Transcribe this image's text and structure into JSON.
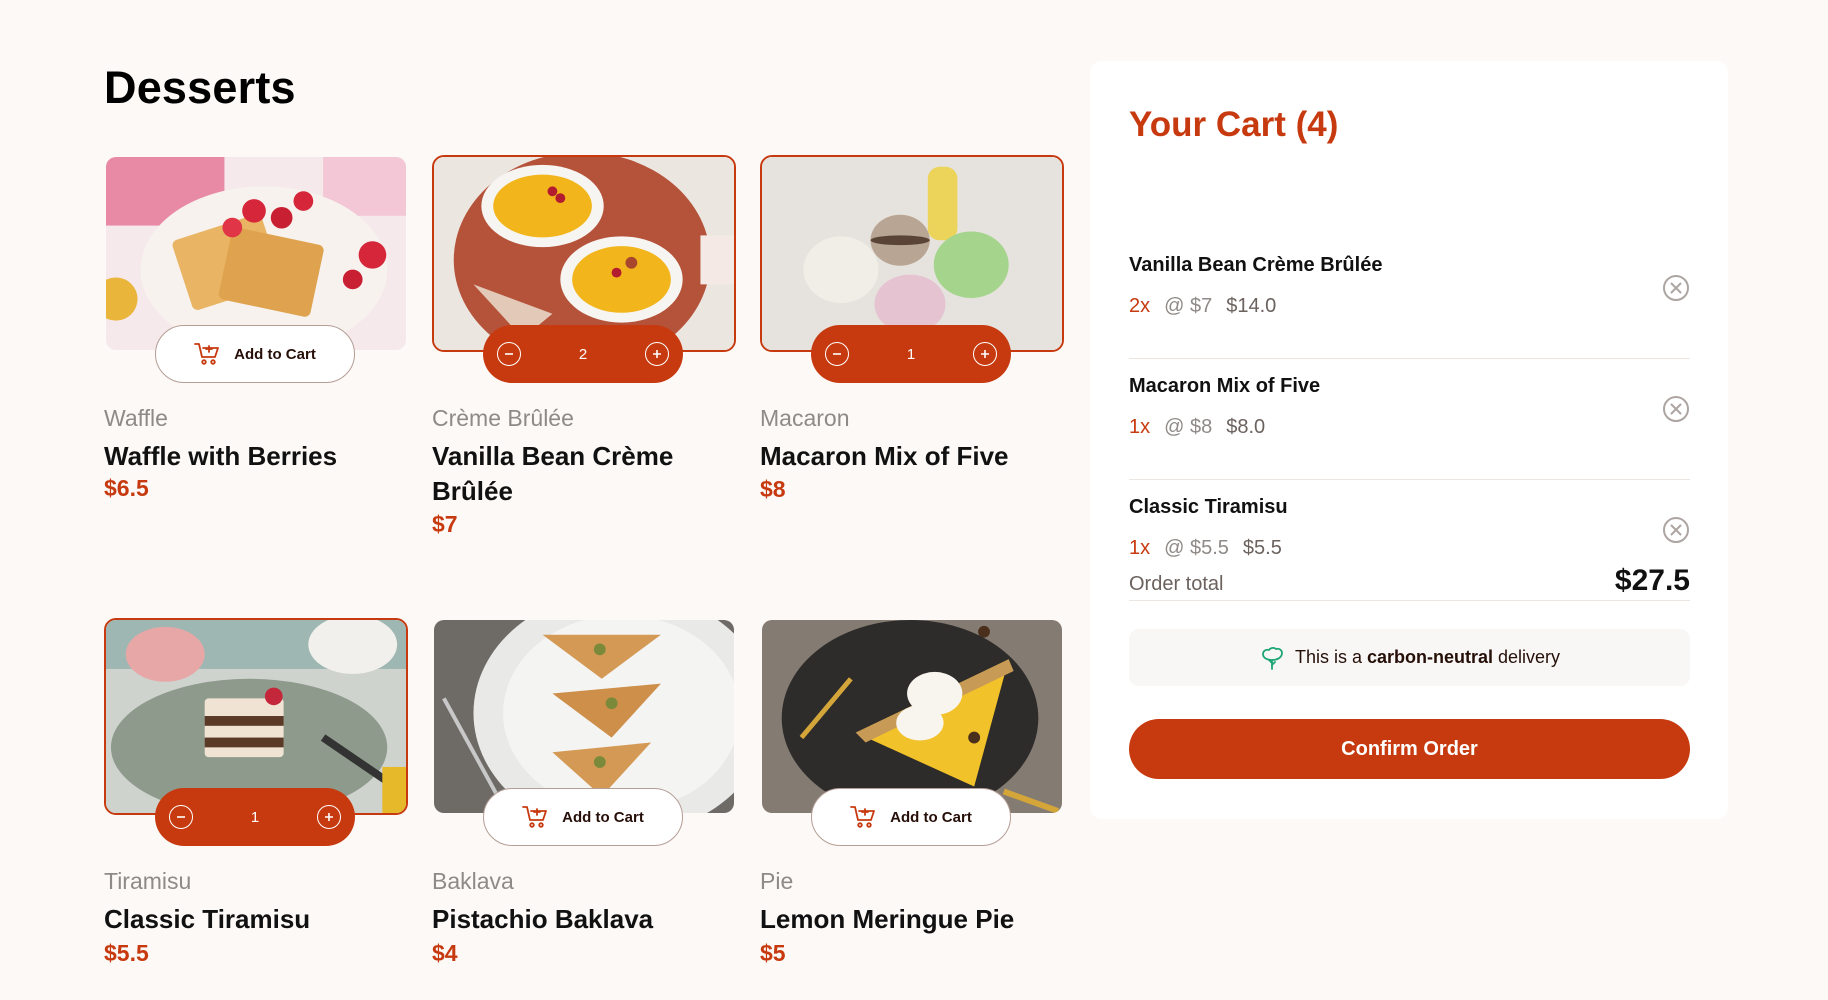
{
  "page": {
    "title": "Desserts"
  },
  "products": [
    {
      "category": "Waffle",
      "name": "Waffle with Berries",
      "price": "$6.5",
      "in_cart": false,
      "add_label": "Add to Cart"
    },
    {
      "category": "Crème Brûlée",
      "name": "Vanilla Bean Crème Brûlée",
      "price": "$7",
      "in_cart": true,
      "quantity": "2"
    },
    {
      "category": "Macaron",
      "name": "Macaron Mix of Five",
      "price": "$8",
      "in_cart": true,
      "quantity": "1"
    },
    {
      "category": "Tiramisu",
      "name": "Classic Tiramisu",
      "price": "$5.5",
      "in_cart": true,
      "quantity": "1"
    },
    {
      "category": "Baklava",
      "name": "Pistachio Baklava",
      "price": "$4",
      "in_cart": false,
      "add_label": "Add to Cart"
    },
    {
      "category": "Pie",
      "name": "Lemon Meringue Pie",
      "price": "$5",
      "in_cart": false,
      "add_label": "Add to Cart"
    }
  ],
  "cart": {
    "title": "Your Cart (4)",
    "items": [
      {
        "name": "Vanilla Bean Crème Brûlée",
        "qty": "2x",
        "unit": "@ $7",
        "total": "$14.0"
      },
      {
        "name": "Macaron Mix of Five",
        "qty": "1x",
        "unit": "@ $8",
        "total": "$8.0"
      },
      {
        "name": "Classic Tiramisu",
        "qty": "1x",
        "unit": "@ $5.5",
        "total": "$5.5"
      }
    ],
    "order_total_label": "Order total",
    "order_total": "$27.5",
    "carbon_prefix": "This is a ",
    "carbon_bold": "carbon-neutral",
    "carbon_suffix": " delivery",
    "confirm_label": "Confirm Order"
  },
  "colors": {
    "accent": "#c73a0f",
    "background": "#fcf9f7",
    "muted": "#8f8a87"
  }
}
